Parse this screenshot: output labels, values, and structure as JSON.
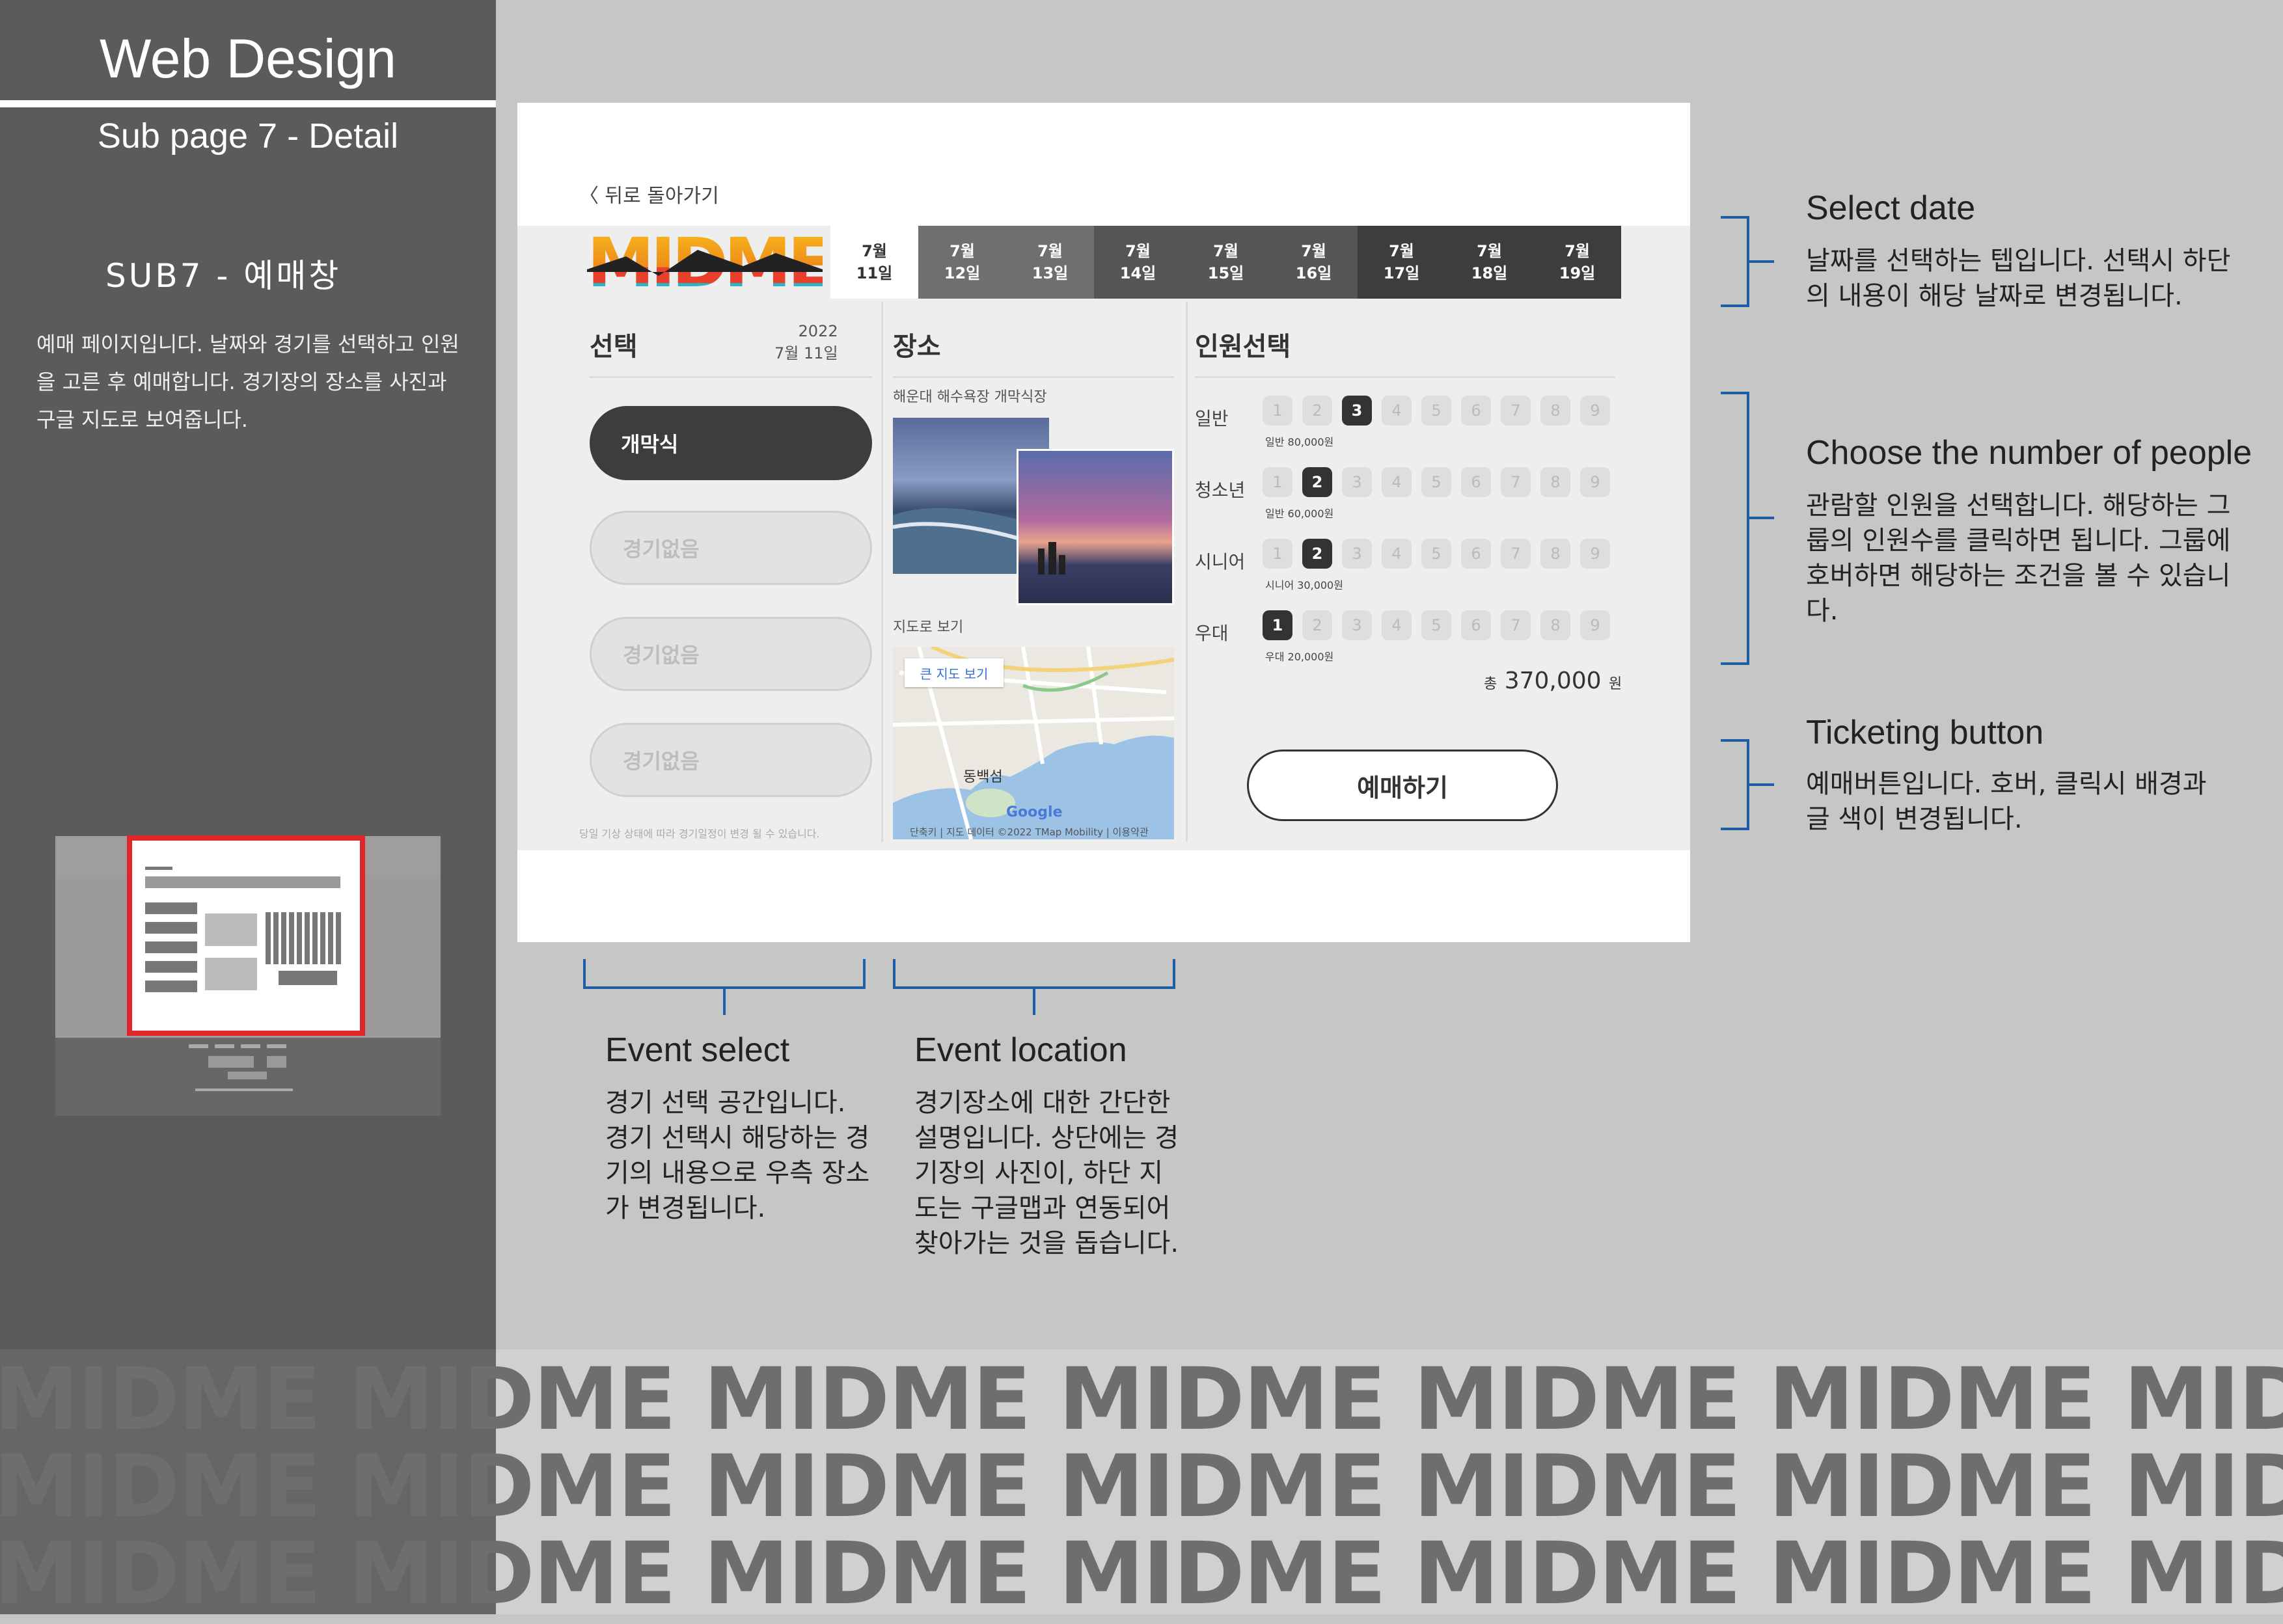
{
  "sidebar": {
    "title": "Web Design",
    "subtitle": "Sub page 7 - Detail",
    "section": "SUB7 - 예매창",
    "description": "예매 페이지입니다. 날짜와 경기를 선택하고 인원을 고른 후 예매합니다. 경기장의 장소를 사진과 구글 지도로 보여줍니다."
  },
  "page": {
    "back_label": "〈 뒤로 돌아가기",
    "logo_text": "MIDME",
    "dates": [
      {
        "month": "7월",
        "day": "11일"
      },
      {
        "month": "7월",
        "day": "12일"
      },
      {
        "month": "7월",
        "day": "13일"
      },
      {
        "month": "7월",
        "day": "14일"
      },
      {
        "month": "7월",
        "day": "15일"
      },
      {
        "month": "7월",
        "day": "16일"
      },
      {
        "month": "7월",
        "day": "17일"
      },
      {
        "month": "7월",
        "day": "18일"
      },
      {
        "month": "7월",
        "day": "19일"
      }
    ],
    "select": {
      "heading": "선택",
      "date_year": "2022",
      "date_day": "7월 11일",
      "events": [
        "개막식",
        "경기없음",
        "경기없음",
        "경기없음"
      ],
      "note": "당일 기상 상태에 따라 경기일정이 변경 될 수 있습니다."
    },
    "location": {
      "heading": "장소",
      "name": "해운대 해수욕장 개막식장",
      "map_label": "지도로 보기",
      "big_map_button": "큰 지도 보기",
      "map_place": "동백섬",
      "map_brand": "Google",
      "map_footer": "단축키 | 지도 데이터 ©2022 TMap Mobility | 이용약관"
    },
    "people": {
      "heading": "인원선택",
      "rows": [
        {
          "label": "일반",
          "price": "일반 80,000원",
          "selected": 3
        },
        {
          "label": "청소년",
          "price": "일반 60,000원",
          "selected": 2
        },
        {
          "label": "시니어",
          "price": "시니어 30,000원",
          "selected": 2
        },
        {
          "label": "우대",
          "price": "우대 20,000원",
          "selected": 1
        }
      ],
      "numbers": [
        "1",
        "2",
        "3",
        "4",
        "5",
        "6",
        "7",
        "8",
        "9"
      ],
      "total_prefix": "총",
      "total": "370,000",
      "total_unit": "원"
    },
    "ticket_button": "예매하기"
  },
  "annotations": {
    "select_date": {
      "title": "Select date",
      "text": "날짜를 선택하는 텝입니다. 선택시 하단의 내용이 해당 날짜로 변경됩니다."
    },
    "people": {
      "title": "Choose the number of people",
      "text": "관람할 인원을 선택합니다. 해당하는 그룹의 인원수를 클릭하면 됩니다. 그룹에 호버하면 해당하는 조건을 볼 수 있습니다."
    },
    "ticketing": {
      "title": "Ticketing button",
      "text": "예매버튼입니다. 호버, 클릭시 배경과 글 색이 변경됩니다."
    },
    "event_select": {
      "title": "Event select",
      "text": "경기 선택 공간입니다. 경기 선택시 해당하는 경기의 내용으로 우측 장소가 변경됩니다."
    },
    "event_location": {
      "title": "Event location",
      "text": "경기장소에 대한 간단한 설명입니다. 상단에는 경기장의 사진이, 하단 지도는 구글맵과 연동되어 찾아가는 것을 돕습니다."
    }
  },
  "watermark": "MIDME",
  "colors": {
    "sidebar": "#5b5b5b",
    "canvas": "#c6c6c6",
    "accent_blue": "#1f5fa8",
    "thumb_red": "#e0262b"
  }
}
